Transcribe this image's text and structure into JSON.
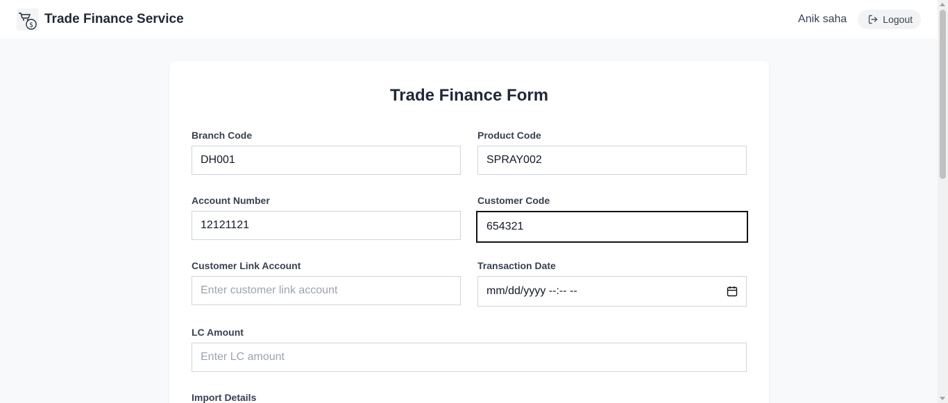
{
  "navbar": {
    "title": "Trade Finance Service",
    "user_name": "Anik saha",
    "logout_label": "Logout"
  },
  "form": {
    "title": "Trade Finance Form",
    "branch_code": {
      "label": "Branch Code",
      "value": "DH001"
    },
    "product_code": {
      "label": "Product Code",
      "value": "SPRAY002"
    },
    "account_number": {
      "label": "Account Number",
      "value": "12121121"
    },
    "customer_code": {
      "label": "Customer Code",
      "value": "654321"
    },
    "customer_link_account": {
      "label": "Customer Link Account",
      "placeholder": "Enter customer link account"
    },
    "transaction_date": {
      "label": "Transaction Date",
      "value": "mm/dd/yyyy --:-- --"
    },
    "lc_amount": {
      "label": "LC Amount",
      "placeholder": "Enter LC amount"
    },
    "import_details": {
      "label": "Import Details"
    }
  },
  "icons": {
    "logo": "trade-finance-logo",
    "logout": "logout-icon",
    "calendar": "calendar-icon"
  },
  "colors": {
    "focus_border": "#111111",
    "input_border": "#cfd4da",
    "page_background": "#f8f9fb"
  }
}
